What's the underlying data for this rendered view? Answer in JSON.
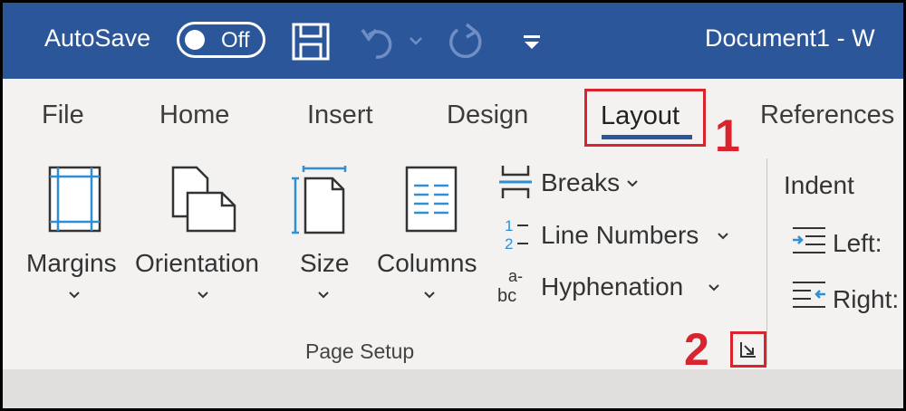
{
  "titlebar": {
    "autosave_label": "AutoSave",
    "autosave_state": "Off",
    "document_title": "Document1  -  W",
    "background_color": "#2b579a",
    "icons": [
      "save-icon",
      "undo-icon",
      "redo-icon",
      "customize-toolbar-icon"
    ]
  },
  "tabs": {
    "file": "File",
    "home": "Home",
    "insert": "Insert",
    "design": "Design",
    "layout": "Layout",
    "references": "References",
    "active": "Layout"
  },
  "ribbon": {
    "page_setup": {
      "margins": "Margins",
      "orientation": "Orientation",
      "size": "Size",
      "columns": "Columns",
      "breaks": "Breaks",
      "line_numbers": "Line Numbers",
      "hyphenation": "Hyphenation",
      "group_label": "Page Setup"
    },
    "paragraph": {
      "indent_label": "Indent",
      "left_label": "Left:",
      "right_label": "Right:"
    }
  },
  "annotations": {
    "step1": "1",
    "step2": "2",
    "highlight_color": "#d9232d"
  }
}
